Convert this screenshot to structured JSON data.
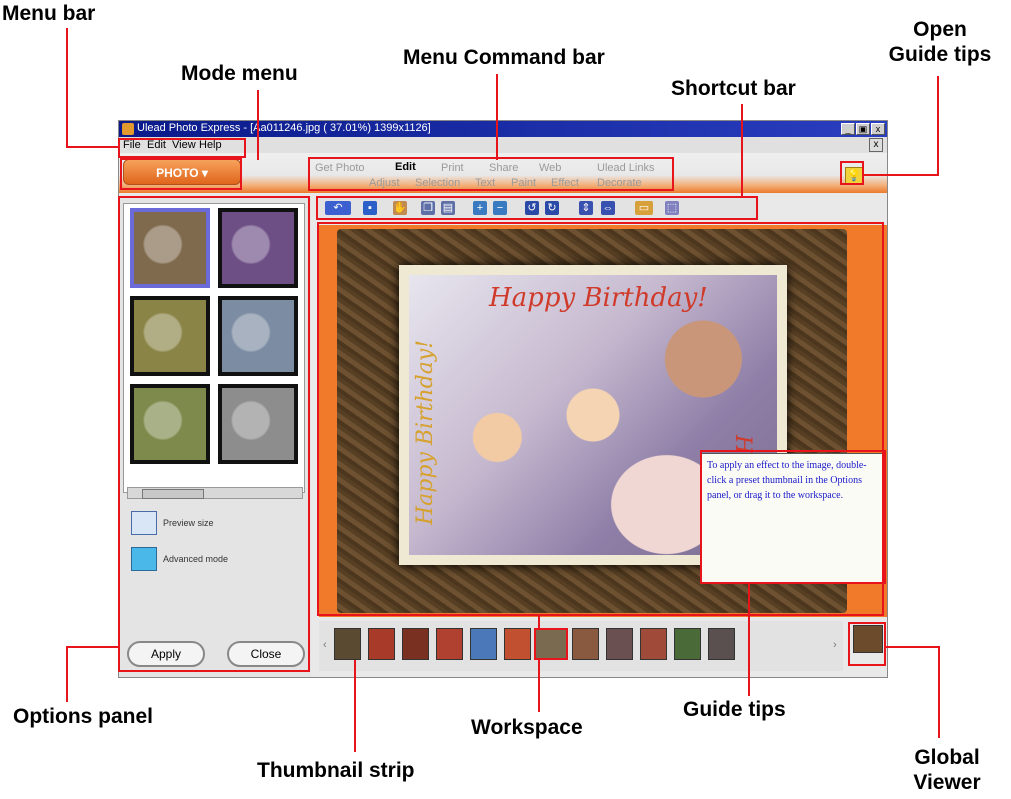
{
  "annotations": {
    "menu_bar": "Menu bar",
    "mode_menu": "Mode menu",
    "menu_command_bar": "Menu Command bar",
    "open_guide_tips": [
      "Open",
      "Guide tips"
    ],
    "shortcut_bar": "Shortcut bar",
    "options_panel": "Options panel",
    "workspace": "Workspace",
    "guide_tips": "Guide tips",
    "thumbnail_strip": "Thumbnail strip",
    "global_viewer": [
      "Global",
      "Viewer"
    ]
  },
  "window": {
    "title": "Ulead Photo Express - [Aa011246.jpg ( 37.01%) 1399x1126]",
    "controls": [
      "_",
      "▣",
      "x"
    ]
  },
  "menubar": {
    "items": [
      "File",
      "Edit",
      "View",
      "Help"
    ],
    "doc_close": "x"
  },
  "mode_menu": {
    "label": "PHOTO"
  },
  "command_tabs": [
    "Get Photo",
    "Edit",
    "Print",
    "Share",
    "Web",
    "Ulead Links"
  ],
  "command_subtabs": [
    "Adjust",
    "Selection",
    "Text",
    "Paint",
    "Effect",
    "Decorate"
  ],
  "active_tab": "Edit",
  "shortcut_icons": [
    "undo-pointer-icon",
    "save-icon",
    "hand-icon",
    "copy-icon",
    "paste-icon",
    "zoom-in-icon",
    "zoom-out-icon",
    "rotate-left-icon",
    "rotate-right-icon",
    "flip-vertical-icon",
    "flip-horizontal-icon",
    "crop-icon",
    "select-icon"
  ],
  "options_panel": {
    "thumbnail_tints": [
      "#7f6a4e",
      "#6d4f86",
      "#8a8446",
      "#7c8ca2",
      "#7e8a4c",
      "#8d8d8d"
    ],
    "preview_size_label": "Preview size",
    "advanced_mode_label": "Advanced mode",
    "apply_label": "Apply",
    "close_label": "Close"
  },
  "workspace": {
    "banner_top": "Happy Birthday!",
    "banner_left": "Happy Birthday!",
    "banner_right": "Happy Bi"
  },
  "guide_tip": {
    "text": "To apply an effect to the image, double-click a preset thumbnail in the Options panel, or drag it to the workspace."
  },
  "thumbnail_strip": {
    "tints": [
      "#5a4a32",
      "#a83a2a",
      "#7a3020",
      "#b04030",
      "#4a78b8",
      "#c05030",
      "#7a6a50",
      "#8a5a40",
      "#6a5050",
      "#a04a3a",
      "#4a6a38",
      "#5a5050"
    ],
    "selected_index": 6
  },
  "colors": {
    "annotation_red": "#e8141c",
    "workspace_orange": "#f07a2a",
    "title_blue": "#0a1a8a"
  }
}
